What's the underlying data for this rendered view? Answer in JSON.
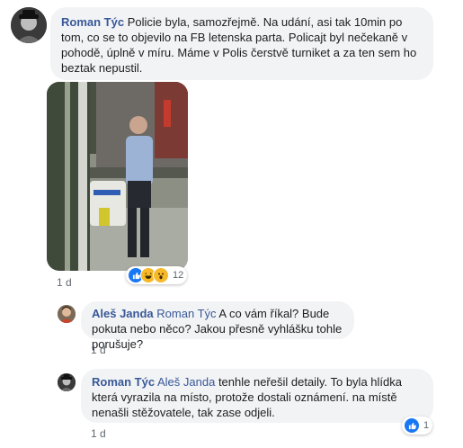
{
  "comments": [
    {
      "author": "Roman Týc",
      "text": "Policie byla, samozřejmě. Na udání, asi tak 10min po tom, co se to objevilo na FB letenska parta. Policajt byl nečekaně v pohodě, úplně v míru. Máme v Polis čerstvě turniket a za ten sem ho beztak nepustil.",
      "time": "1 d",
      "reactions": {
        "icons": [
          "like-icon",
          "haha-icon",
          "wow-icon"
        ],
        "count": "12"
      }
    }
  ],
  "replies": [
    {
      "author": "Aleš Janda",
      "mention": "Roman Týc",
      "text": "A co vám říkal? Bude pokuta nebo něco? Jakou přesně vyhlášku tohle porušuje?",
      "time": "1 d"
    },
    {
      "author": "Roman Týc",
      "mention": "Aleš Janda",
      "text": "tenhle neřešil detaily. To byla hlídka která vyrazila na místo, protože dostali oznámení. na místě nenašli stěžovatele, tak zase odjeli.",
      "time": "1 d",
      "reactions": {
        "icons": [
          "like-icon"
        ],
        "count": "1"
      }
    }
  ],
  "colors": {
    "link": "#385898",
    "bubble": "#f2f3f5",
    "like": "#1877f2",
    "meta": "#606770"
  }
}
